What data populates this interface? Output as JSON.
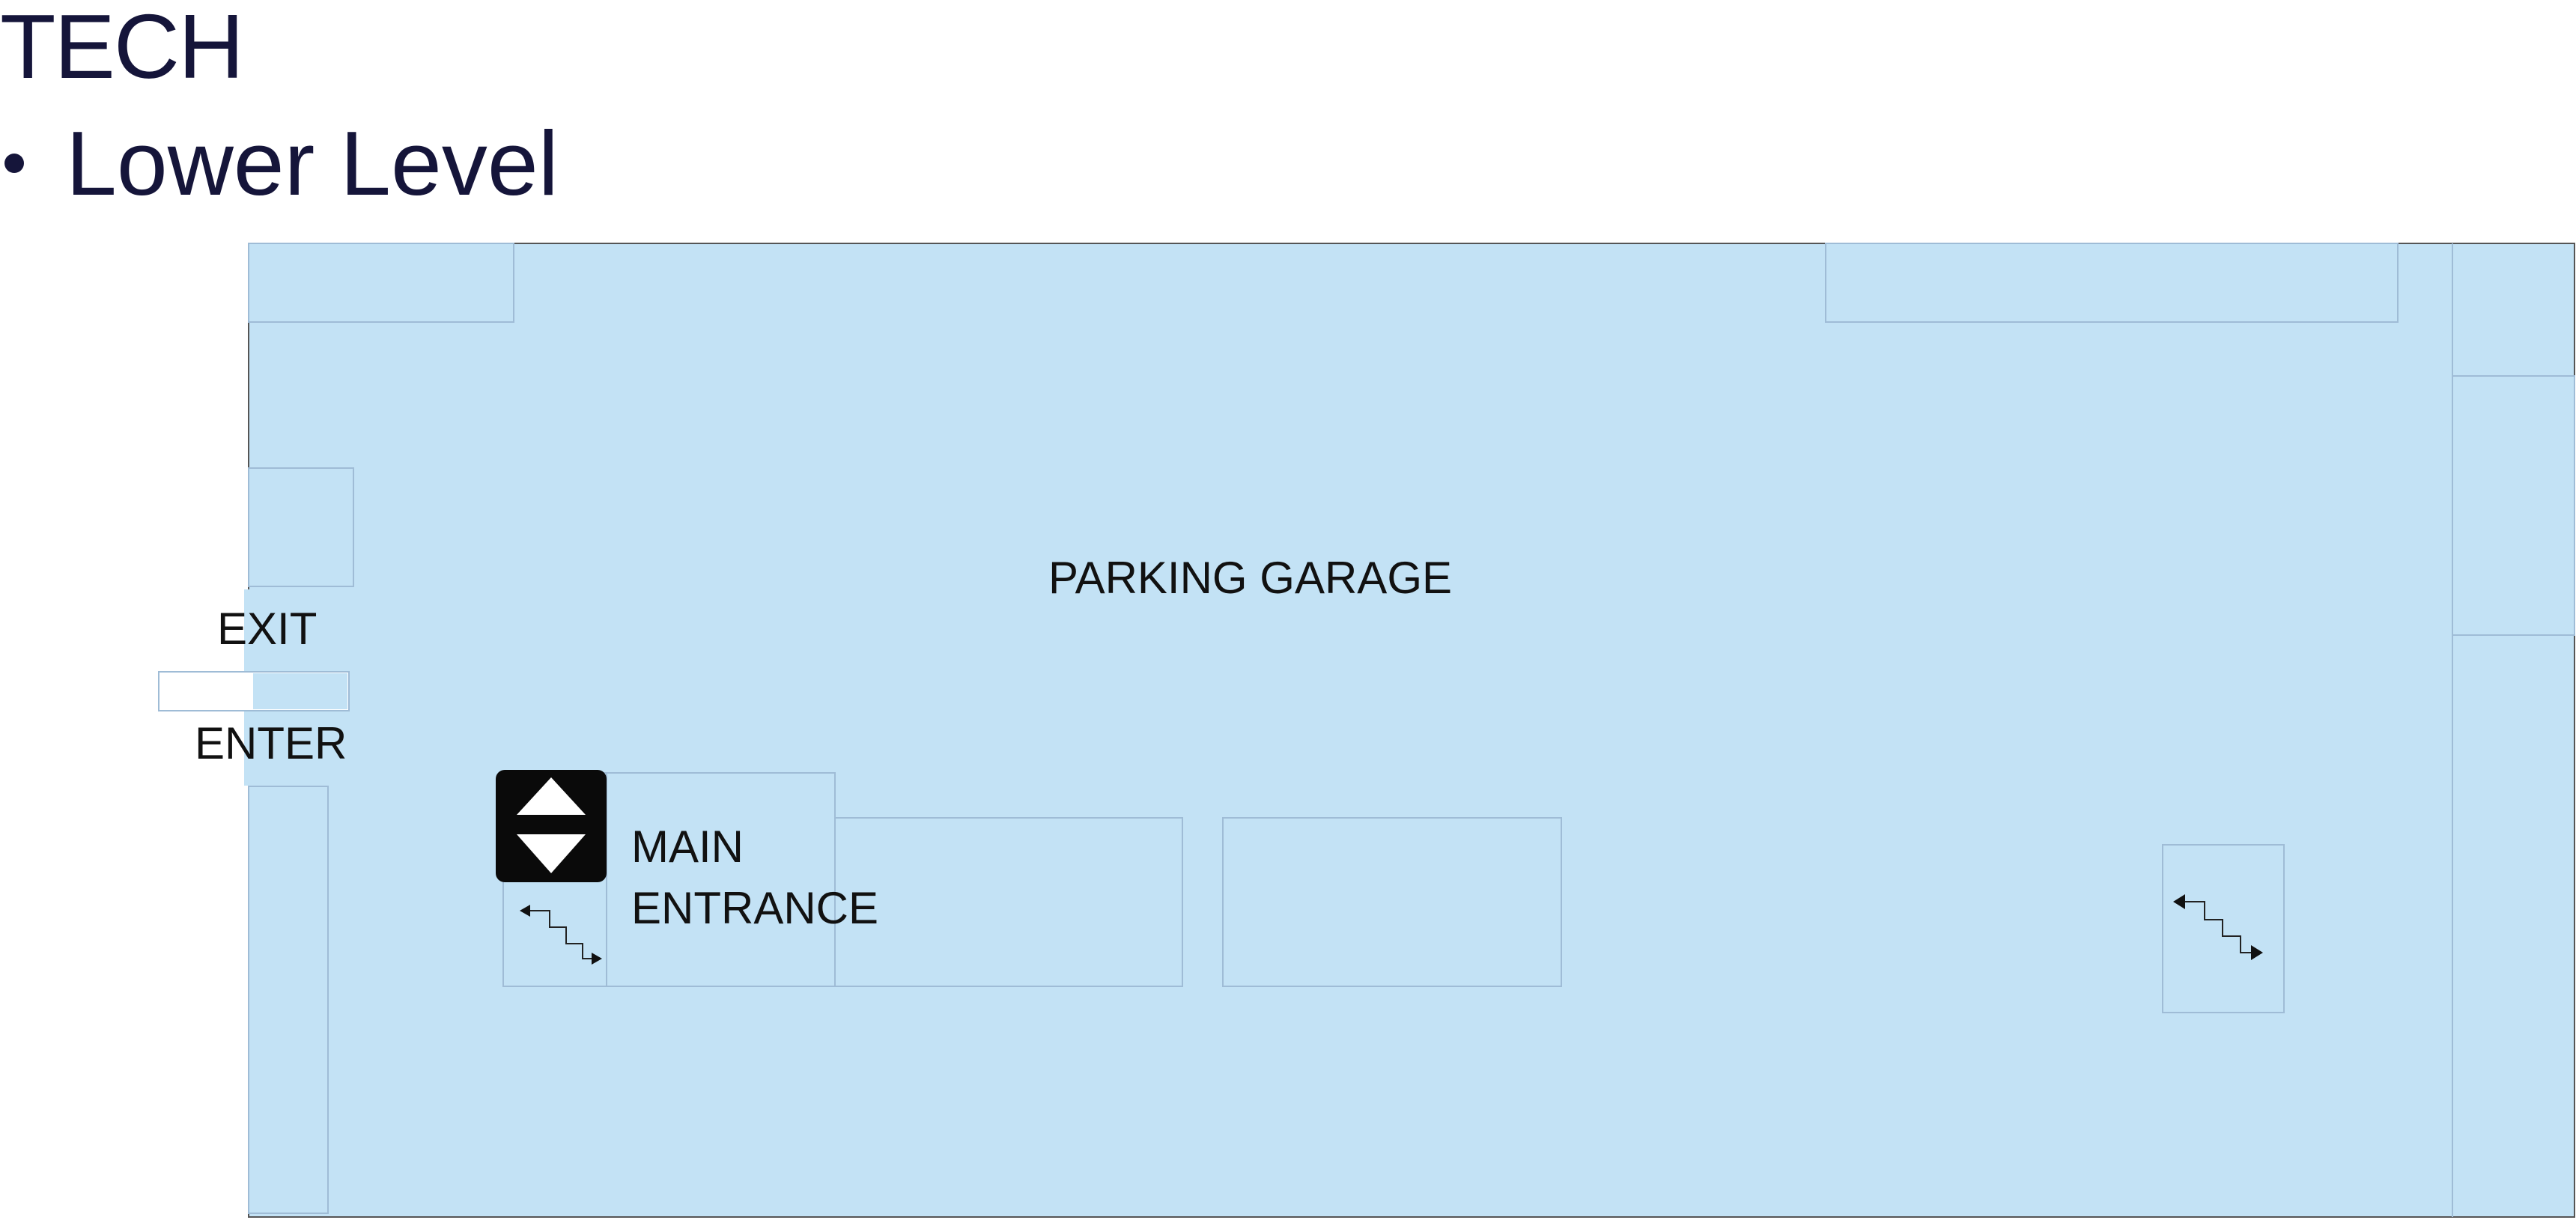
{
  "header": {
    "title": "TECH",
    "bullet_text": "Lower Level"
  },
  "map": {
    "labels": {
      "parking": "PARKING GARAGE",
      "exit": "EXIT",
      "enter": "ENTER",
      "main_line1": "MAIN",
      "main_line2": "ENTRANCE"
    },
    "colors": {
      "fill": "#c3e2f5",
      "room_stroke": "#9fbcd6",
      "outline": "#555555",
      "elevator": "#0a0a0a"
    },
    "icons": [
      "elevator-icon",
      "stairs-icon",
      "stairs-icon"
    ]
  }
}
